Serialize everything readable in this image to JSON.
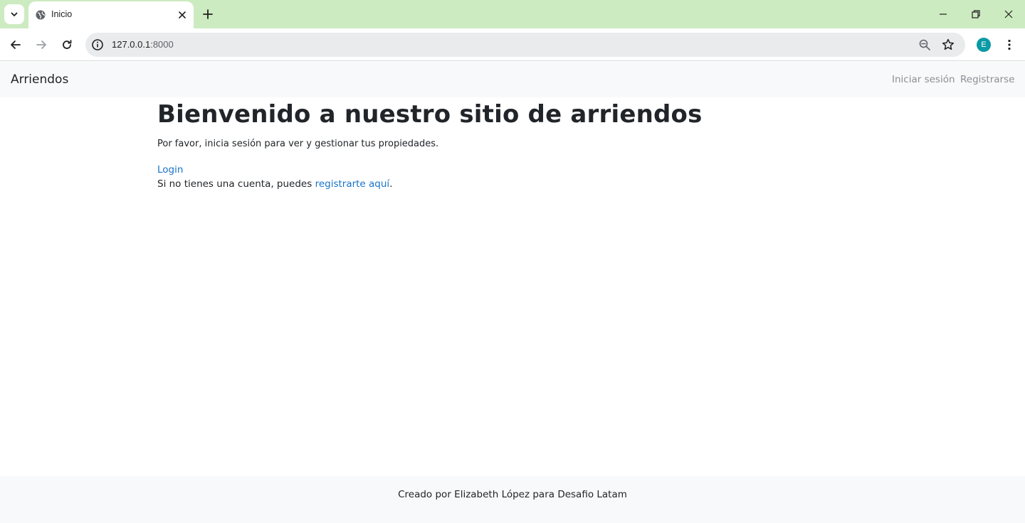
{
  "browser": {
    "tab": {
      "title": "Inicio",
      "favicon": "globe-icon"
    },
    "address": {
      "host": "127.0.0.1",
      "port": ":8000"
    },
    "profile_initial": "E",
    "colors": {
      "tabstrip": "#cdebc0",
      "avatar": "#0b9aa6"
    }
  },
  "navbar": {
    "brand": "Arriendos",
    "links": [
      {
        "label": "Iniciar sesión"
      },
      {
        "label": "Registrarse"
      }
    ]
  },
  "main": {
    "title": "Bienvenido a nuestro sitio de arriendos",
    "intro": "Por favor, inicia sesión para ver y gestionar tus propiedades.",
    "login_link": "Login",
    "register_prefix": "Si no tienes una cuenta, puedes ",
    "register_link": "registrarte aquí",
    "register_suffix": "."
  },
  "footer": {
    "text": "Creado por Elizabeth López para Desafio Latam"
  }
}
